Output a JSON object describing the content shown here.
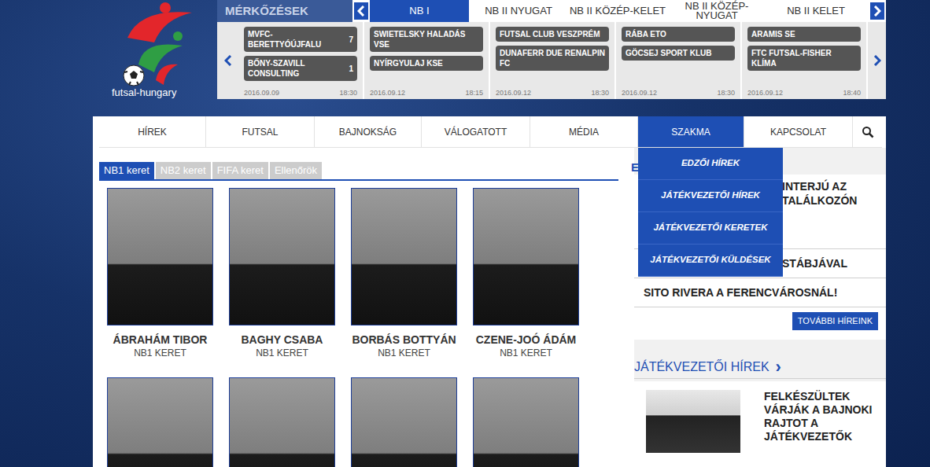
{
  "logo": {
    "text": "futsal-hungary"
  },
  "matches": {
    "title": "MÉRKŐZÉSEK",
    "tabs": [
      {
        "label": "NB I",
        "selected": true
      },
      {
        "label": "NB II NYUGAT",
        "selected": false
      },
      {
        "label": "NB II KÖZÉP-KELET",
        "selected": false
      },
      {
        "label": "NB II KÖZÉP-NYUGAT",
        "selected": false
      },
      {
        "label": "NB II KELET",
        "selected": false
      }
    ],
    "games": [
      {
        "home": "MVFC-BERETTYÓÚJFALU",
        "home_score": "7",
        "away": "BŐNY-SZAVILL CONSULTING",
        "away_score": "1",
        "date": "2016.09.09",
        "time": "18:30"
      },
      {
        "home": "SWIETELSKY HALADÁS VSE",
        "away": "NYÍRGYULAJ KSE",
        "date": "2016.09.12",
        "time": "18:15"
      },
      {
        "home": "FUTSAL CLUB VESZPRÉM",
        "away": "DUNAFERR DUE RENALPIN FC",
        "date": "2016.09.12",
        "time": "18:30"
      },
      {
        "home": "RÁBA ETO",
        "away": "GÖCSEJ SPORT KLUB",
        "date": "2016.09.12",
        "time": "18:30"
      },
      {
        "home": "ARAMIS SE",
        "away": "FTC FUTSAL-FISHER KLÍMA",
        "date": "2016.09.12",
        "time": "18:40"
      }
    ]
  },
  "nav": {
    "items": [
      {
        "label": "HÍREK",
        "selected": false
      },
      {
        "label": "FUTSAL",
        "selected": false
      },
      {
        "label": "BAJNOKSÁG",
        "selected": false
      },
      {
        "label": "VÁLOGATOTT",
        "selected": false
      },
      {
        "label": "MÉDIA",
        "selected": false
      },
      {
        "label": "SZAKMA",
        "selected": true
      },
      {
        "label": "KAPCSOLAT",
        "selected": false
      }
    ],
    "dropdown": [
      "EDZŐI HÍREK",
      "JÁTÉKVEZETŐI HÍREK",
      "JÁTÉKVEZETŐI KERETEK",
      "JÁTÉKVEZETŐI KÜLDÉSEK"
    ]
  },
  "referee_tabs": [
    {
      "label": "NB1 keret",
      "selected": true
    },
    {
      "label": "NB2 keret",
      "selected": false
    },
    {
      "label": "FIFA keret",
      "selected": false
    },
    {
      "label": "Ellenőrök",
      "selected": false
    }
  ],
  "referees": [
    {
      "kind": "named",
      "name": "ÁBRAHÁM TIBOR",
      "group": "NB1 KERET"
    },
    {
      "kind": "named",
      "name": "BAGHY CSABA",
      "group": "NB1 KERET"
    },
    {
      "kind": "named",
      "name": "BORBÁS BOTTYÁN",
      "group": "NB1 KERET"
    },
    {
      "kind": "named",
      "name": "CZENE-JOÓ ÁDÁM",
      "group": "NB1 KERET"
    },
    {
      "kind": "photo"
    },
    {
      "kind": "photo"
    },
    {
      "kind": "photo"
    },
    {
      "kind": "photo"
    }
  ],
  "news": {
    "heading": "E",
    "items": [
      {
        "lines": [
          "INTERJÚ AZ",
          "TALÁLKOZÓN"
        ],
        "covered": true
      },
      {
        "lines": [
          "STÁBJÁVAL"
        ],
        "covered": true
      },
      {
        "lines": [
          "SITO RIVERA A FERENCVÁROSNÁL!"
        ],
        "covered": false
      }
    ],
    "more": "TOVÁBBI HÍREINK"
  },
  "referee_news": {
    "heading": "JÁTÉKVEZETŐI HÍREK",
    "arrow": "›",
    "items": [
      {
        "title": "FELKÉSZÜLTEK VÁRJÁK A BAJNOKI RAJTOT A JÁTÉKVEZETŐK"
      }
    ]
  }
}
